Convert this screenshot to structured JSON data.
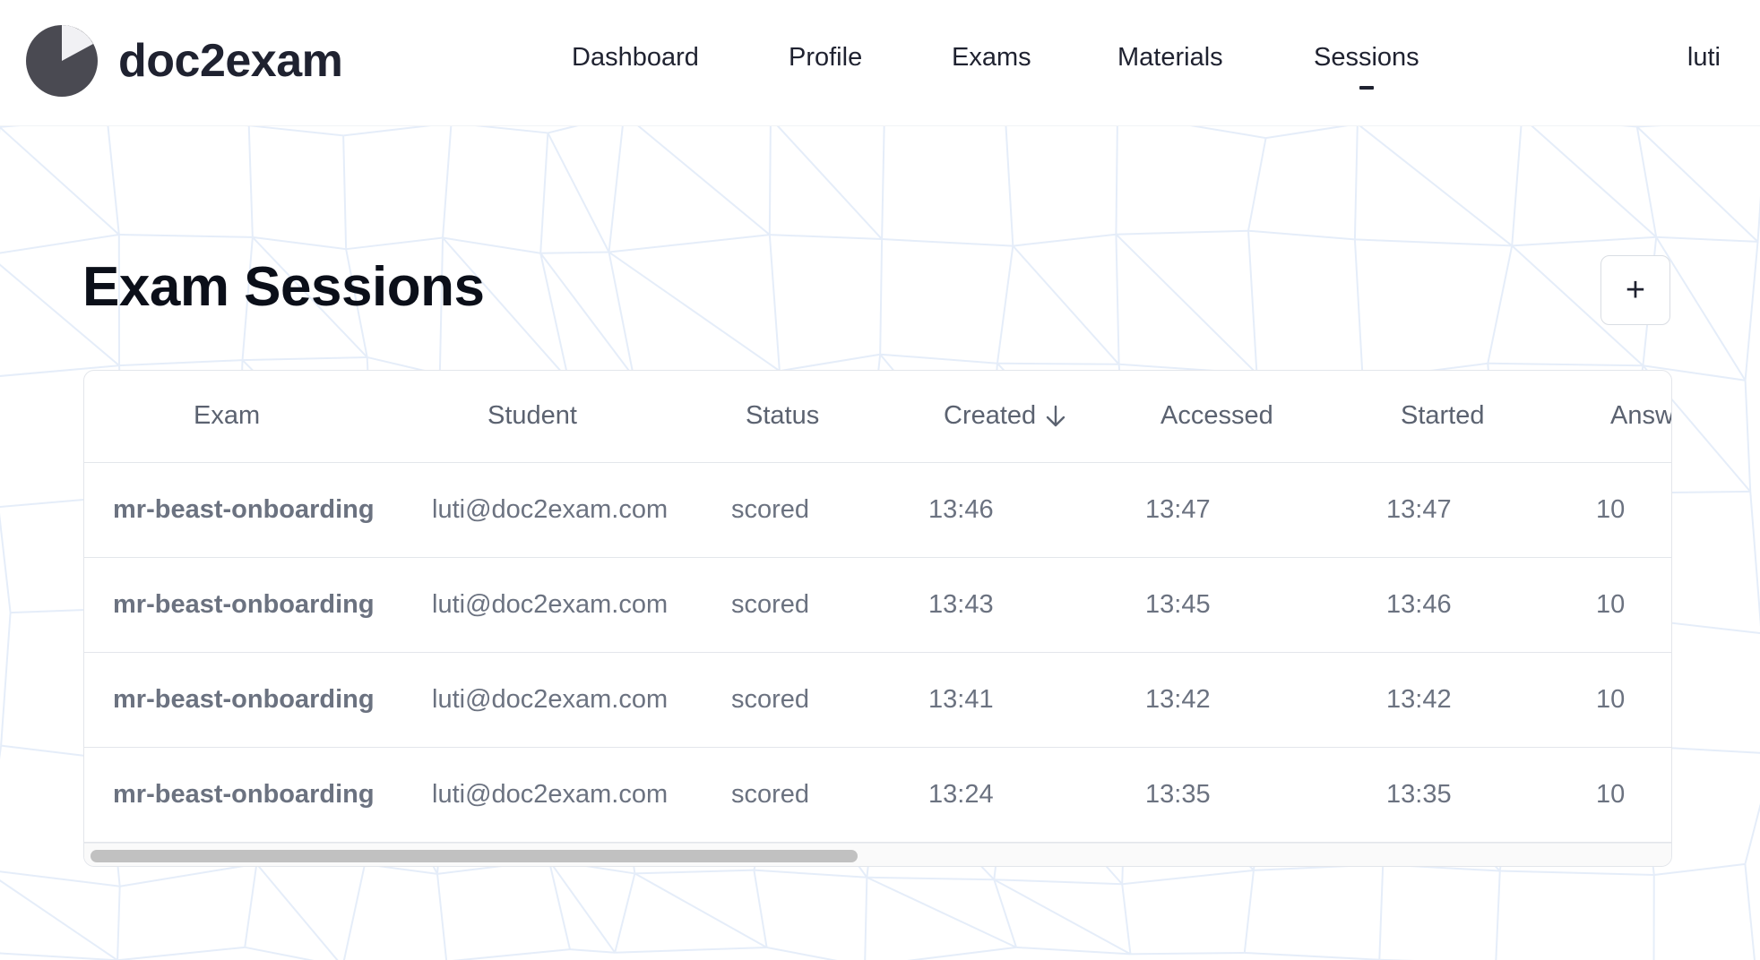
{
  "app": {
    "name": "doc2exam"
  },
  "nav": {
    "items": [
      {
        "label": "Dashboard",
        "active": false
      },
      {
        "label": "Profile",
        "active": false
      },
      {
        "label": "Exams",
        "active": false
      },
      {
        "label": "Materials",
        "active": false
      },
      {
        "label": "Sessions",
        "active": true
      }
    ],
    "user": "luti"
  },
  "page": {
    "title": "Exam Sessions",
    "add_button_label": "+"
  },
  "table": {
    "columns": [
      "Exam",
      "Student",
      "Status",
      "Created",
      "Accessed",
      "Started",
      "Answ"
    ],
    "sort_column": "Created",
    "sort_direction": "descending",
    "rows": [
      {
        "exam": "mr-beast-onboarding",
        "student": "luti@doc2exam.com",
        "status": "scored",
        "created": "13:46",
        "accessed": "13:47",
        "started": "13:47",
        "answered": "10"
      },
      {
        "exam": "mr-beast-onboarding",
        "student": "luti@doc2exam.com",
        "status": "scored",
        "created": "13:43",
        "accessed": "13:45",
        "started": "13:46",
        "answered": "10"
      },
      {
        "exam": "mr-beast-onboarding",
        "student": "luti@doc2exam.com",
        "status": "scored",
        "created": "13:41",
        "accessed": "13:42",
        "started": "13:42",
        "answered": "10"
      },
      {
        "exam": "mr-beast-onboarding",
        "student": "luti@doc2exam.com",
        "status": "scored",
        "created": "13:24",
        "accessed": "13:35",
        "started": "13:35",
        "answered": "10"
      }
    ]
  },
  "colors": {
    "brand_dark": "#4a4a52",
    "text_primary": "#1f2230",
    "text_muted": "#6b7280",
    "border": "#e3e6eb",
    "mesh": "#dde8f7"
  },
  "icons": {
    "logo": "pie-clock-icon",
    "add": "plus-icon",
    "sort": "arrow-down-icon"
  }
}
